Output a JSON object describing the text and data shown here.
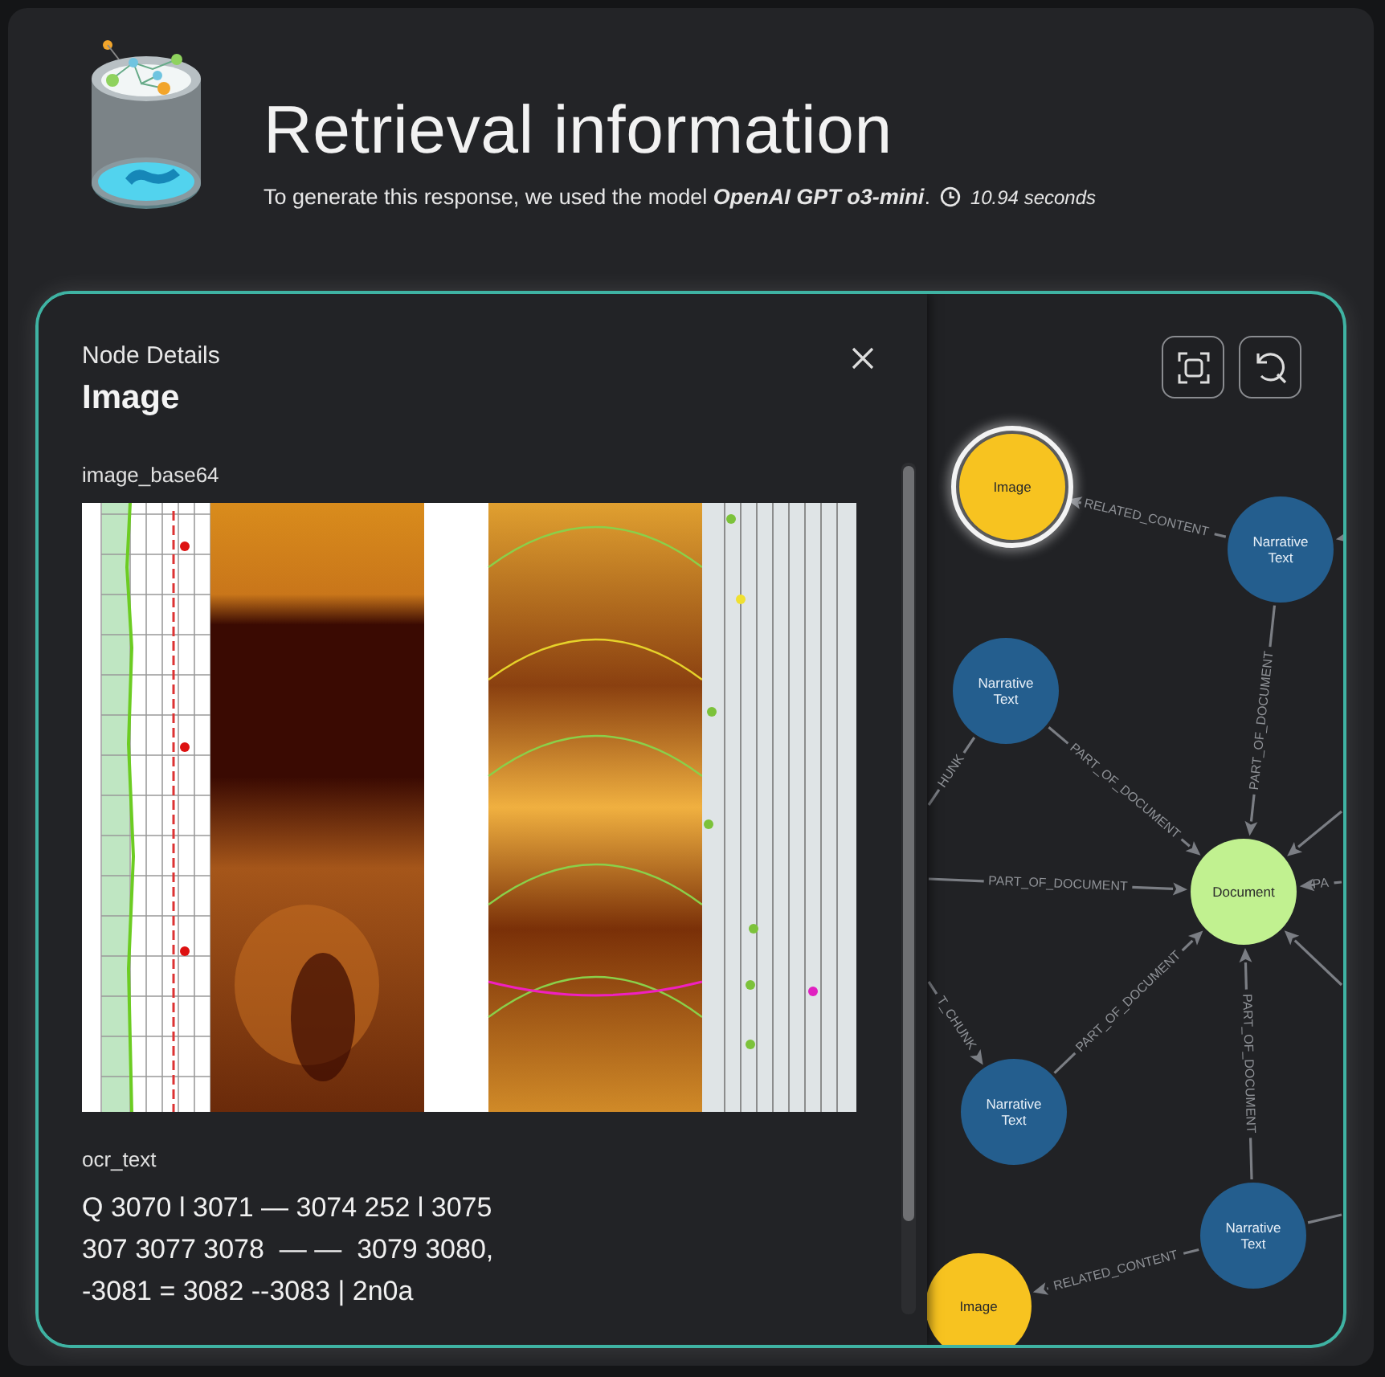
{
  "header": {
    "title": "Retrieval information",
    "subtitle": "To generate this response, we used the model **OpenAI GPT o3-mini**.",
    "duration": "10.94 seconds"
  },
  "node_details": {
    "heading": "Node Details",
    "title": "Image",
    "fields": [
      {
        "label": "image_base64",
        "kind": "image"
      },
      {
        "label": "ocr_text",
        "kind": "text",
        "lines": [
          "Q 3070 l 3071 — 3074 252 l 3075",
          "307 3077 3078  — —  3079 3080,",
          "-3081 = 3082 --3083 | 2n0a"
        ]
      }
    ]
  },
  "graph": {
    "nodes": [
      {
        "kind": "image",
        "label": "Image",
        "selected": true
      },
      {
        "kind": "narrative",
        "label": "Narrative Text",
        "selected": false
      },
      {
        "kind": "narrative",
        "label": "Narrative Text",
        "selected": false
      },
      {
        "kind": "document",
        "label": "Document",
        "selected": false
      },
      {
        "kind": "narrative",
        "label": "Narrative Text",
        "selected": false
      },
      {
        "kind": "narrative",
        "label": "Narrative Text",
        "selected": false
      },
      {
        "kind": "image",
        "label": "Image",
        "selected": false
      }
    ],
    "edges": [
      {
        "label": "RELATED_CONTENT"
      },
      {
        "label": "PART_OF_DOCUMENT"
      },
      {
        "label": "PART_OF_DOCUMENT"
      },
      {
        "label": "PART_OF_DOCUMENT"
      },
      {
        "label": "PART_OF_DOCUMENT"
      },
      {
        "label": "PART_OF_DOCUMENT"
      },
      {
        "label": "RELATED_CONTENT"
      },
      {
        "label": "HUNK"
      },
      {
        "label": "T_CHUNK"
      },
      {
        "label": "PA"
      }
    ]
  }
}
